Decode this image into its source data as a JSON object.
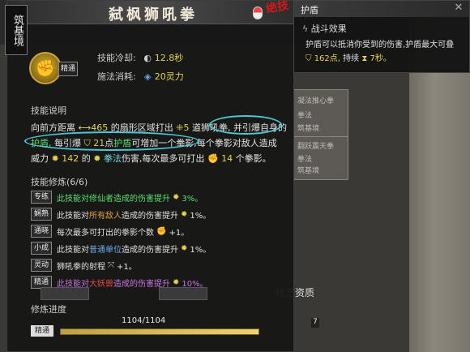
{
  "skill": {
    "title": "弑枫狮吼拳",
    "realm": "筑基境",
    "grade": "精通",
    "badge": "绝技",
    "cooldown_label": "技能冷却:",
    "cooldown_value": "12.8秒",
    "cost_label": "施法消耗:",
    "cost_value": "20灵力"
  },
  "description": {
    "heading": "技能说明",
    "line1_a": "向前方距离",
    "line1_dist": "465",
    "line1_b": "的扇形区域打出",
    "line1_count": "5",
    "line1_c": "道狮吼拳,",
    "line1_d": "并引爆自身的",
    "line2_a": "护盾,",
    "line2_b": "每引爆",
    "line2_val": "21",
    "line2_c": "点",
    "line2_d": "护盾",
    "line2_e": "可增加一个拳影,",
    "line2_f": "每个拳影对敌人造成",
    "line3_a": "威力",
    "line3_val": "142",
    "line3_b": "的",
    "line3_c": "拳法",
    "line3_d": "伤害,每次最多可打出",
    "line3_max": "14",
    "line3_e": "个拳影。"
  },
  "cultivation": {
    "heading": "技能修炼(6/6)",
    "rows": [
      {
        "tag": "专练",
        "a": "此技能对",
        "b": "修仙者",
        "c": "造成的伤害提升",
        "val": "3%。",
        "color": "c-green"
      },
      {
        "tag": "娴熟",
        "a": "此技能对",
        "b": "所有敌人",
        "c": "造成的伤害提升",
        "val": "1%。",
        "color": ""
      },
      {
        "tag": "通晓",
        "a": "每次最多可打出的拳影个数",
        "b": "",
        "c": "",
        "val": "+1。",
        "color": ""
      },
      {
        "tag": "小成",
        "a": "此技能对",
        "b": "普通单位",
        "c": "造成的伤害提升",
        "val": "1%。",
        "color": "c-blue"
      },
      {
        "tag": "灵动",
        "a": "狮吼拳的射程",
        "b": "",
        "c": "",
        "val": "+1。",
        "color": ""
      },
      {
        "tag": "精通",
        "a": "此技能对",
        "b": "大妖兽",
        "c": "造成的伤害提升",
        "val": "10%。",
        "color": "c-purple"
      }
    ]
  },
  "progress": {
    "heading": "修炼进度",
    "tier": "精通",
    "current": "1104/1104",
    "fraction": 1.0
  },
  "popup": {
    "title": "护盾",
    "subtitle": "战斗效果",
    "line1": "护盾可以抵消你受到的伤害,护盾最大可叠",
    "line2_val": "162点,",
    "line2_b": "持续",
    "line2_dur": "7秒。"
  },
  "background": {
    "cards": [
      "凝法推心拳",
      "拳法",
      "筑基境",
      "翻跃震天拳",
      "拳法",
      "筑基境"
    ],
    "tab_bottom": "技艺资质",
    "side_values": [
      "7"
    ]
  }
}
